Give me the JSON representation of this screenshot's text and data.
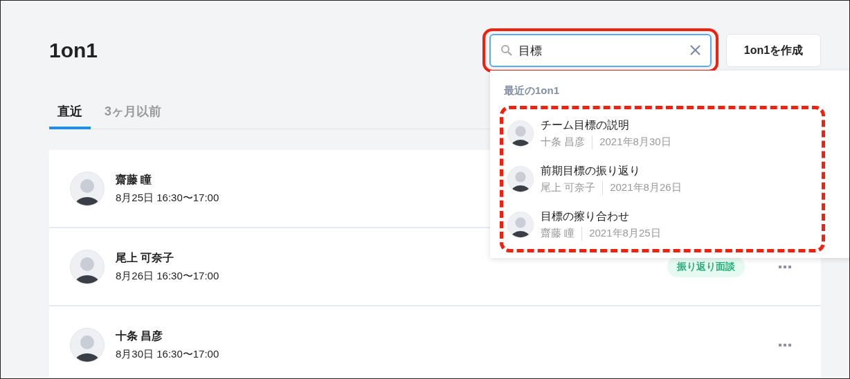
{
  "page": {
    "title": "1on1"
  },
  "search": {
    "value": "目標"
  },
  "create_button": "1on1を作成",
  "tabs": [
    {
      "label": "直近",
      "selected": true
    },
    {
      "label": "3ヶ月以前",
      "selected": false
    }
  ],
  "meetings": [
    {
      "name": "齋藤 瞳",
      "time": "8月25日 16:30〜17:00",
      "menu": false
    },
    {
      "name": "尾上 可奈子",
      "time": "8月26日 16:30〜17:00",
      "tag": "振り返り面談",
      "menu": true
    },
    {
      "name": "十条 昌彦",
      "time": "8月30日 16:30〜17:00",
      "menu": true
    }
  ],
  "dropdown": {
    "heading": "最近の1on1",
    "results": [
      {
        "title": "チーム目標の説明",
        "person": "十条 昌彦",
        "date": "2021年8月30日"
      },
      {
        "title": "前期目標の振り返り",
        "person": "尾上 可奈子",
        "date": "2021年8月26日"
      },
      {
        "title": "目標の擦り合わせ",
        "person": "齋藤 瞳",
        "date": "2021年8月25日"
      }
    ]
  }
}
